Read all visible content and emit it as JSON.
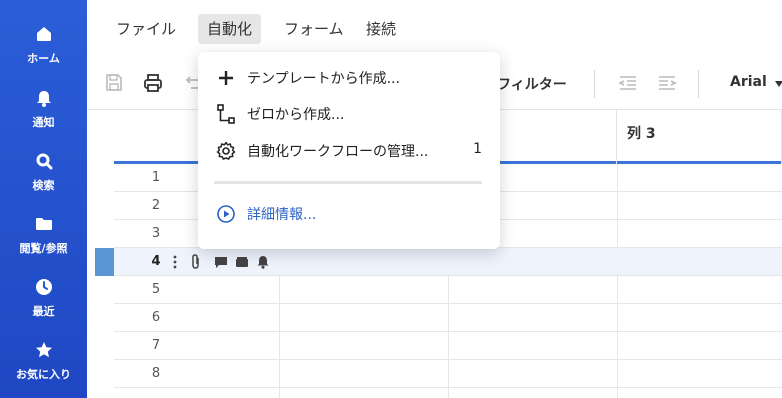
{
  "sidebar": {
    "items": [
      {
        "label": "ホーム",
        "icon": "home-icon"
      },
      {
        "label": "通知",
        "icon": "bell-icon"
      },
      {
        "label": "検索",
        "icon": "search-icon"
      },
      {
        "label": "閲覧/参照",
        "icon": "folder-icon"
      },
      {
        "label": "最近",
        "icon": "clock-icon"
      },
      {
        "label": "お気に入り",
        "icon": "star-icon"
      }
    ],
    "bg_color": "#2459d4"
  },
  "menubar": {
    "items": [
      "ファイル",
      "自動化",
      "フォーム",
      "接続"
    ],
    "active": "自動化"
  },
  "toolbar": {
    "filter_label": "フィルター",
    "font": "Arial"
  },
  "grid": {
    "column3_label": "列 3",
    "rows": [
      "1",
      "2",
      "3",
      "4",
      "5",
      "6",
      "7",
      "8"
    ],
    "selected_row": "4"
  },
  "dropdown": {
    "items": [
      {
        "label": "テンプレートから作成...",
        "icon": "plus-icon"
      },
      {
        "label": "ゼロから作成...",
        "icon": "workflow-icon"
      },
      {
        "label": "自動化ワークフローの管理...",
        "icon": "gear-icon",
        "count": "1"
      },
      {
        "label": "詳細情報...",
        "icon": "play-circle-icon"
      }
    ]
  }
}
